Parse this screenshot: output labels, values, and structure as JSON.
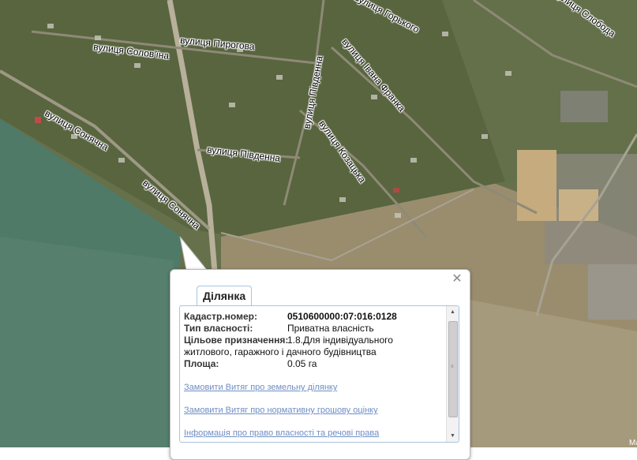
{
  "map": {
    "streets": [
      {
        "id": "vulytsia-solovina",
        "label": "вулиця Солов'їна"
      },
      {
        "id": "vulytsia-pyrohova",
        "label": "вулиця Пирогова"
      },
      {
        "id": "vulytsia-hlodkoho",
        "label": "вулиця Горького"
      },
      {
        "id": "vulytsia-sloboda",
        "label": "вулиця Слобода"
      },
      {
        "id": "vulytsia-pivdenna-1",
        "label": "вулиця Південна"
      },
      {
        "id": "vulytsia-ivana-franka",
        "label": "вулиця Івана Франка"
      },
      {
        "id": "vulytsia-soniachna-1",
        "label": "вулиця Сонячна"
      },
      {
        "id": "vulytsia-pivdenna-2",
        "label": "вулиця Південна"
      },
      {
        "id": "vulytsia-kozatska",
        "label": "вулиця Козацька"
      },
      {
        "id": "vulytsia-soniachna-2",
        "label": "вулиця Сонячна"
      }
    ],
    "attribution": "Ма"
  },
  "popup": {
    "tab_label": "Ділянка",
    "close_symbol": "✕",
    "fields": {
      "cadastral": {
        "label": "Кадастр.номер:",
        "value": "0510600000:07:016:0128"
      },
      "ownership": {
        "label": "Тип власності:",
        "value": "Приватна власність"
      },
      "purpose": {
        "label": "Цільове призначення:",
        "value_line1": "1.8.Для індивідуального",
        "value_line2": "житлового, гаражного і дачного будівництва"
      },
      "area": {
        "label": "Площа:",
        "value": "0.05 га"
      }
    },
    "links": [
      "Замовити Витяг про земельну ділянку",
      "Замовити Витяг про нормативну грошову оцінку",
      "Інформація про право власності та речові права"
    ]
  }
}
